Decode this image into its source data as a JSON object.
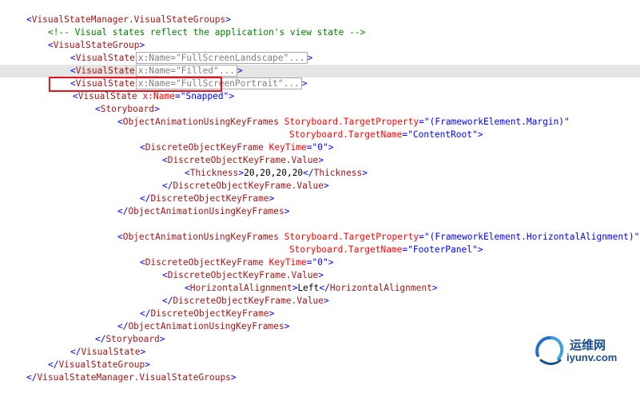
{
  "code": {
    "l1_open": "<",
    "l1_name": "VisualStateManager.VisualStateGroups",
    "l1_close": ">",
    "l2_comment": "<!-- Visual states reflect the application's view state -->",
    "l3_open": "<",
    "l3_name": "VisualStateGroup",
    "l3_close": ">",
    "l4_open": "<",
    "l4_name": "VisualState",
    "l4_fold": "x:Name=\"FullScreenLandscape\"...",
    "l4_close": ">",
    "l5_open": "<",
    "l5_name": "VisualState",
    "l5_fold": "x:Name=\"Filled\"...",
    "l5_close": ">",
    "l6_open": "<",
    "l6_name": "VisualState",
    "l6_fold": "x:Name=\"FullScreenPortrait\"...",
    "l6_close": ">",
    "l7_open": "<",
    "l7_name": "VisualState",
    "l7_attr": "x:Name",
    "l7_eq": "=",
    "l7_val": "\"Snapped\"",
    "l7_close": ">",
    "l8_open": "<",
    "l8_name": "Storyboard",
    "l8_close": ">",
    "l9_open": "<",
    "l9_name": "ObjectAnimationUsingKeyFrames",
    "l9_attr": "Storyboard.TargetProperty",
    "l9_eq": "=",
    "l9_val": "\"(FrameworkElement.Margin)\"",
    "l10_attr": "Storyboard.TargetName",
    "l10_eq": "=",
    "l10_val": "\"ContentRoot\"",
    "l10_close": ">",
    "l11_open": "<",
    "l11_name": "DiscreteObjectKeyFrame",
    "l11_attr": "KeyTime",
    "l11_eq": "=",
    "l11_val": "\"0\"",
    "l11_close": ">",
    "l12_open": "<",
    "l12_name": "DiscreteObjectKeyFrame.Value",
    "l12_close": ">",
    "l13_open": "<",
    "l13_name": "Thickness",
    "l13_gt": ">",
    "l13_text": "20,20,20,20",
    "l13_lt": "</",
    "l13_name2": "Thickness",
    "l13_close": ">",
    "l14_open": "</",
    "l14_name": "DiscreteObjectKeyFrame.Value",
    "l14_close": ">",
    "l15_open": "</",
    "l15_name": "DiscreteObjectKeyFrame",
    "l15_close": ">",
    "l16_open": "</",
    "l16_name": "ObjectAnimationUsingKeyFrames",
    "l16_close": ">",
    "l18_open": "<",
    "l18_name": "ObjectAnimationUsingKeyFrames",
    "l18_attr": "Storyboard.TargetProperty",
    "l18_eq": "=",
    "l18_val": "\"(FrameworkElement.HorizontalAlignment)\"",
    "l19_attr": "Storyboard.TargetName",
    "l19_eq": "=",
    "l19_val": "\"FooterPanel\"",
    "l19_close": ">",
    "l20_open": "<",
    "l20_name": "DiscreteObjectKeyFrame",
    "l20_attr": "KeyTime",
    "l20_eq": "=",
    "l20_val": "\"0\"",
    "l20_close": ">",
    "l21_open": "<",
    "l21_name": "DiscreteObjectKeyFrame.Value",
    "l21_close": ">",
    "l22_open": "<",
    "l22_name": "HorizontalAlignment",
    "l22_gt": ">",
    "l22_text": "Left",
    "l22_lt": "</",
    "l22_name2": "HorizontalAlignment",
    "l22_close": ">",
    "l23_open": "</",
    "l23_name": "DiscreteObjectKeyFrame.Value",
    "l23_close": ">",
    "l24_open": "</",
    "l24_name": "DiscreteObjectKeyFrame",
    "l24_close": ">",
    "l25_open": "</",
    "l25_name": "ObjectAnimationUsingKeyFrames",
    "l25_close": ">",
    "l26_open": "</",
    "l26_name": "Storyboard",
    "l26_close": ">",
    "l27_open": "</",
    "l27_name": "VisualState",
    "l27_close": ">",
    "l28_open": "</",
    "l28_name": "VisualStateGroup",
    "l28_close": ">",
    "l29_open": "</",
    "l29_name": "VisualStateManager.VisualStateGroups",
    "l29_close": ">"
  },
  "watermark": {
    "cn_text": "运维网",
    "url_text": "iyunv.com"
  },
  "colors": {
    "tag_bracket": "#0000ff",
    "element_name": "#a31515",
    "attribute_name": "#ff0000",
    "attribute_value": "#0000ff",
    "comment": "#008000",
    "highlight_box": "#e8121d",
    "current_line": "#e5e5e5"
  }
}
